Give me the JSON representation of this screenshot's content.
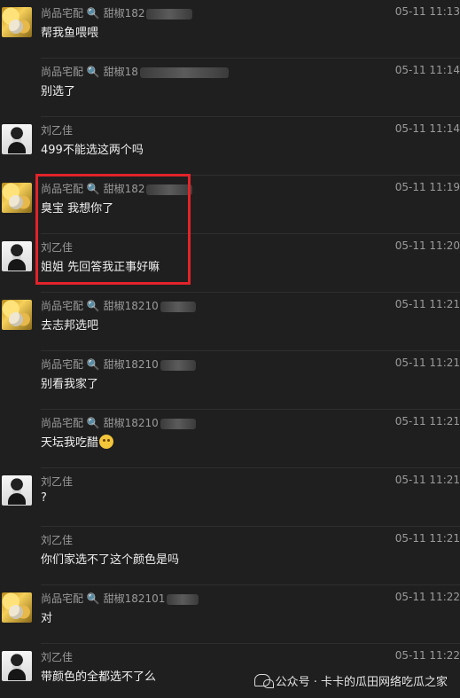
{
  "messages": [
    {
      "sender": "尚品宅配 🔍 甜椒182",
      "sender_has_redaction": true,
      "time": "05-11 11:13",
      "text": "帮我鱼喂喂",
      "avatar": "gold-avatar-icon",
      "show_avatar": true
    },
    {
      "sender": "尚品宅配 🔍 甜椒18",
      "sender_has_redaction": true,
      "time": "05-11 11:14",
      "text": "别选了",
      "avatar": "",
      "show_avatar": false
    },
    {
      "sender": "刘乙佳",
      "sender_has_redaction": false,
      "time": "05-11 11:14",
      "text": "499不能选这两个吗",
      "avatar": "person-avatar-icon",
      "show_avatar": true
    },
    {
      "sender": "尚品宅配 🔍 甜椒182",
      "sender_has_redaction": true,
      "time": "05-11 11:19",
      "text": "臭宝 我想你了",
      "avatar": "gold-avatar-icon",
      "show_avatar": true
    },
    {
      "sender": "刘乙佳",
      "sender_has_redaction": false,
      "time": "05-11 11:20",
      "text": "姐姐 先回答我正事好嘛",
      "avatar": "person-avatar-icon",
      "show_avatar": true
    },
    {
      "sender": "尚品宅配 🔍 甜椒18210",
      "sender_has_redaction": true,
      "time": "05-11 11:21",
      "text": "去志邦选吧",
      "avatar": "gold-avatar-icon",
      "show_avatar": true
    },
    {
      "sender": "尚品宅配 🔍 甜椒18210",
      "sender_has_redaction": true,
      "time": "05-11 11:21",
      "text": "别看我家了",
      "avatar": "",
      "show_avatar": false
    },
    {
      "sender": "尚品宅配 🔍 甜椒18210",
      "sender_has_redaction": true,
      "time": "05-11 11:21",
      "text": "天坛我吃醋",
      "avatar": "",
      "show_avatar": false,
      "emoji": "laugh-emoji-icon"
    },
    {
      "sender": "刘乙佳",
      "sender_has_redaction": false,
      "time": "05-11 11:21",
      "text": "?",
      "avatar": "person-avatar-icon",
      "show_avatar": true
    },
    {
      "sender": "刘乙佳",
      "sender_has_redaction": false,
      "time": "05-11 11:21",
      "text": "你们家选不了这个颜色是吗",
      "avatar": "",
      "show_avatar": false
    },
    {
      "sender": "尚品宅配 🔍 甜椒182101",
      "sender_has_redaction": true,
      "time": "05-11 11:22",
      "text": "对",
      "avatar": "gold-avatar-icon",
      "show_avatar": true
    },
    {
      "sender": "刘乙佳",
      "sender_has_redaction": false,
      "time": "05-11 11:22",
      "text": "带颜色的全都选不了么",
      "avatar": "person-avatar-icon",
      "show_avatar": true
    }
  ],
  "watermark": {
    "text": "公众号 · 卡卡的瓜田网络吃瓜之家",
    "icon": "wechat-icon"
  },
  "colors": {
    "background": "#1f1f1f",
    "text": "#efefef",
    "meta": "#9b9b9b",
    "highlight_border": "#e2232a"
  }
}
